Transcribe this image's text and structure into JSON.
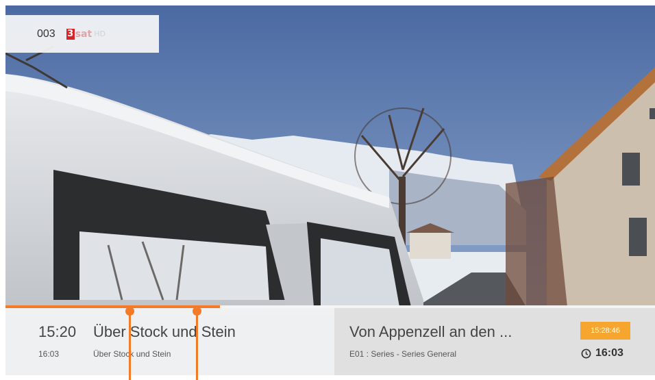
{
  "channel": {
    "number": "003",
    "logo_mark": "3",
    "logo_word": "sat",
    "logo_hd": "HD"
  },
  "current_program": {
    "start_time": "15:20",
    "title": "Über Stock und Stein",
    "end_time": "16:03",
    "subtitle": "Über Stock und Stein",
    "progress_fraction": 0.33
  },
  "next_program": {
    "title": "Von Appenzell an den ...",
    "subtitle": "E01 : Series - Series General",
    "current_clock": "15:28:46",
    "end_time": "16:03"
  },
  "icons": {
    "clock": "clock-icon"
  },
  "colors": {
    "accent": "#f37b27",
    "clock_badge": "#f6a62f",
    "logo_red": "#d8232a"
  }
}
